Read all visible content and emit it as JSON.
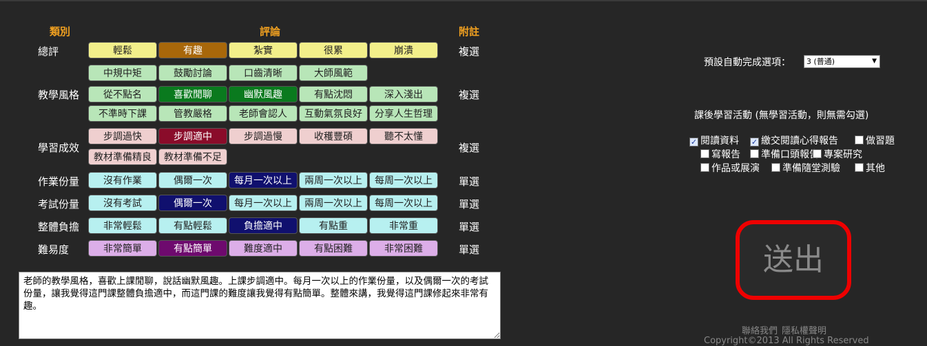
{
  "headers": {
    "category": "類別",
    "comment": "評論",
    "note": "附註"
  },
  "rows": [
    {
      "label": "總評",
      "note": "複選",
      "options": [
        {
          "text": "輕鬆",
          "bg": "#f2ef8a",
          "selected": false
        },
        {
          "text": "有趣",
          "bg": "#a8670a",
          "selected": true
        },
        {
          "text": "紮實",
          "bg": "#f2ef8a",
          "selected": false
        },
        {
          "text": "很累",
          "bg": "#f2ef8a",
          "selected": false
        },
        {
          "text": "崩潰",
          "bg": "#f2ef8a",
          "selected": false
        }
      ]
    },
    {
      "label": "教學風格",
      "note": "複選",
      "options": [
        {
          "text": "中規中矩",
          "bg": "#b8e6b8",
          "selected": false
        },
        {
          "text": "鼓勵討論",
          "bg": "#b8e6b8",
          "selected": false
        },
        {
          "text": "口齒清晰",
          "bg": "#b8e6b8",
          "selected": false
        },
        {
          "text": "大師風範",
          "bg": "#b8e6b8",
          "selected": false
        },
        {
          "text": "從不點名",
          "bg": "#b8e6b8",
          "selected": false
        },
        {
          "text": "喜歡閒聊",
          "bg": "#0a7a1e",
          "selected": true
        },
        {
          "text": "幽默風趣",
          "bg": "#0a7a1e",
          "selected": true
        },
        {
          "text": "有點沈悶",
          "bg": "#b8e6b8",
          "selected": false
        },
        {
          "text": "深入淺出",
          "bg": "#b8e6b8",
          "selected": false
        },
        {
          "text": "不準時下課",
          "bg": "#b8e6b8",
          "selected": false
        },
        {
          "text": "管教嚴格",
          "bg": "#b8e6b8",
          "selected": false
        },
        {
          "text": "老師會認人",
          "bg": "#b8e6b8",
          "selected": false
        },
        {
          "text": "互動氣氛良好",
          "bg": "#b8e6b8",
          "selected": false
        },
        {
          "text": "分享人生哲理",
          "bg": "#b8e6b8",
          "selected": false
        }
      ]
    },
    {
      "label": "學習成效",
      "note": "複選",
      "options": [
        {
          "text": "步調過快",
          "bg": "#efcfcf",
          "selected": false
        },
        {
          "text": "步調適中",
          "bg": "#8a0c2a",
          "selected": true
        },
        {
          "text": "步調過慢",
          "bg": "#efcfcf",
          "selected": false
        },
        {
          "text": "收穫豐碩",
          "bg": "#efcfcf",
          "selected": false
        },
        {
          "text": "聽不太懂",
          "bg": "#efcfcf",
          "selected": false
        },
        {
          "text": "教材準備精良",
          "bg": "#efcfcf",
          "selected": false
        },
        {
          "text": "教材準備不足",
          "bg": "#efcfcf",
          "selected": false
        }
      ]
    },
    {
      "label": "作業份量",
      "note": "單選",
      "options": [
        {
          "text": "沒有作業",
          "bg": "#b7f0f0",
          "selected": false
        },
        {
          "text": "偶爾一次",
          "bg": "#b7f0f0",
          "selected": false
        },
        {
          "text": "每月一次以上",
          "bg": "#10106e",
          "selected": true
        },
        {
          "text": "兩周一次以上",
          "bg": "#b7f0f0",
          "selected": false
        },
        {
          "text": "每周一次以上",
          "bg": "#b7f0f0",
          "selected": false
        }
      ]
    },
    {
      "label": "考試份量",
      "note": "單選",
      "options": [
        {
          "text": "沒有考試",
          "bg": "#b7f0f0",
          "selected": false
        },
        {
          "text": "偶爾一次",
          "bg": "#10106e",
          "selected": true
        },
        {
          "text": "每月一次以上",
          "bg": "#b7f0f0",
          "selected": false
        },
        {
          "text": "兩周一次以上",
          "bg": "#b7f0f0",
          "selected": false
        },
        {
          "text": "每周一次以上",
          "bg": "#b7f0f0",
          "selected": false
        }
      ]
    },
    {
      "label": "整體負擔",
      "note": "單選",
      "options": [
        {
          "text": "非常輕鬆",
          "bg": "#b7f0f0",
          "selected": false
        },
        {
          "text": "有點輕鬆",
          "bg": "#b7f0f0",
          "selected": false
        },
        {
          "text": "負擔適中",
          "bg": "#10106e",
          "selected": true
        },
        {
          "text": "有點重",
          "bg": "#b7f0f0",
          "selected": false
        },
        {
          "text": "非常重",
          "bg": "#b7f0f0",
          "selected": false
        }
      ]
    },
    {
      "label": "難易度",
      "note": "單選",
      "options": [
        {
          "text": "非常簡單",
          "bg": "#dcaee8",
          "selected": false
        },
        {
          "text": "有點簡單",
          "bg": "#6e0a6e",
          "selected": true
        },
        {
          "text": "難度適中",
          "bg": "#dcaee8",
          "selected": false
        },
        {
          "text": "有點困難",
          "bg": "#dcaee8",
          "selected": false
        },
        {
          "text": "非常困難",
          "bg": "#dcaee8",
          "selected": false
        }
      ]
    }
  ],
  "comment_text": "老師的教學風格，喜歡上課閒聊，說話幽默風趣。上課步調適中。每月一次以上的作業份量，以及偶爾一次的考試份量，讓我覺得這門課整體負擔適中，而這門課的難度讓我覺得有點簡單。整體來講，我覺得這門課修起來非常有趣。",
  "default_label": "預設自動完成選項：",
  "default_value": "3 (普通)",
  "activity_title": "課後學習活動 (無學習活動，則無需勾選)",
  "activities": [
    {
      "text": "閱讀資料",
      "checked": true
    },
    {
      "text": "繳交閱讀心得報告",
      "checked": true
    },
    {
      "text": "做習題",
      "checked": false
    },
    {
      "text": "寫報告",
      "checked": false
    },
    {
      "text": "準備口頭報告",
      "checked": false
    },
    {
      "text": "專案研究",
      "checked": false
    },
    {
      "text": "作品或展演",
      "checked": false
    },
    {
      "text": "準備隨堂測驗",
      "checked": false
    },
    {
      "text": "其他",
      "checked": false
    }
  ],
  "submit_label": "送出",
  "footer": {
    "contact": "聯絡我們",
    "privacy": "隱私權聲明",
    "copyright": "Copyright©2013 All Rights Reserved"
  }
}
